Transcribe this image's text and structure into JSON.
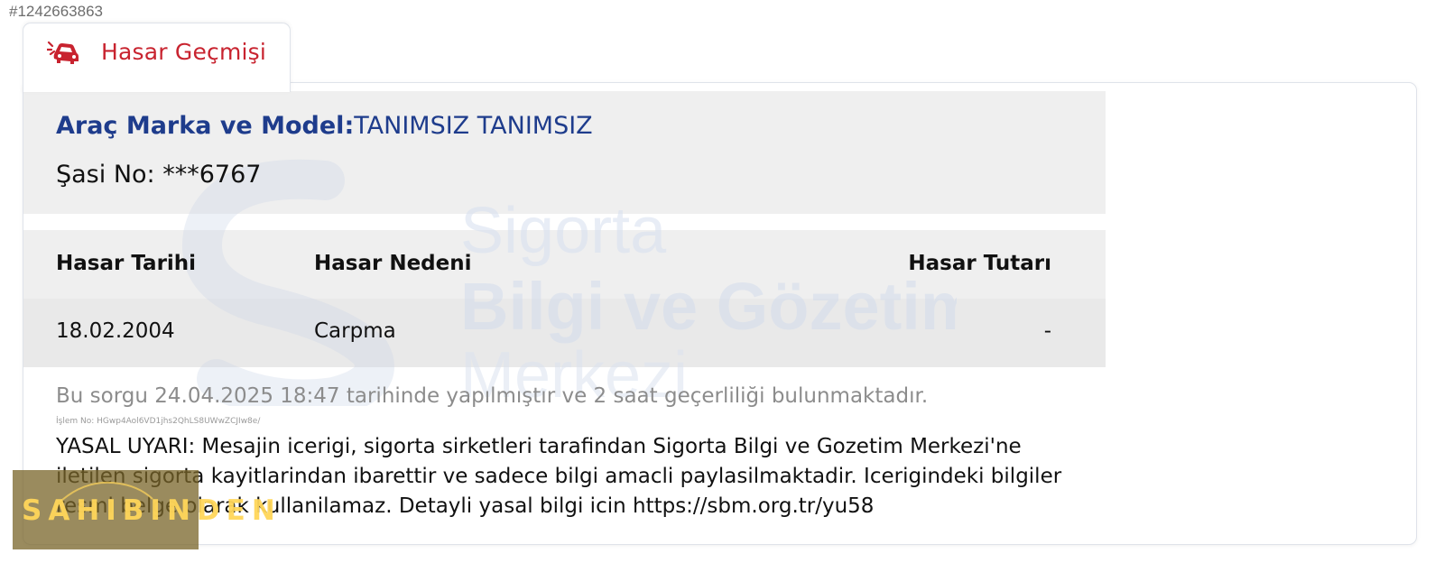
{
  "record_id": "#1242663863",
  "tab": {
    "icon": "car-crash-icon",
    "label": "Hasar Geçmişi"
  },
  "vehicle": {
    "label": "Araç Marka ve Model:",
    "value": "TANIMSIZ TANIMSIZ",
    "chassis": "Şasi No: ***6767"
  },
  "table": {
    "headers": [
      "Hasar Tarihi",
      "Hasar Nedeni",
      "Hasar Tutarı"
    ],
    "rows": [
      [
        "18.02.2004",
        "Carpma",
        "-"
      ]
    ]
  },
  "query_note": "Bu sorgu 24.04.2025 18:47 tarihinde yapılmıştır ve 2 saat geçerliliği bulunmaktadır.",
  "transaction_no": "İşlem No: HGwp4Aol6VD1jhs2QhLS8UWwZCJIw8e/",
  "legal_warning": "YASAL UYARI: Mesajin icerigi, sigorta sirketleri tarafindan Sigorta Bilgi ve Gozetim Merkezi'ne iletilen sigorta kayitlarindan ibarettir ve sadece bilgi amacli paylasilmaktadir. Icerigindeki bilgiler resmi belge olarak kullanilamaz. Detayli yasal bilgi icin https://sbm.org.tr/yu58",
  "watermark": {
    "line1": "Sigorta",
    "line2": "Bilgi ve Gözetim",
    "line3": "Merkezi"
  },
  "logo": {
    "text": "SAHIBINDEN"
  },
  "colors": {
    "tab_accent": "#c8232f",
    "vehicle_label": "#1e3c8c",
    "band": "#efefef"
  }
}
